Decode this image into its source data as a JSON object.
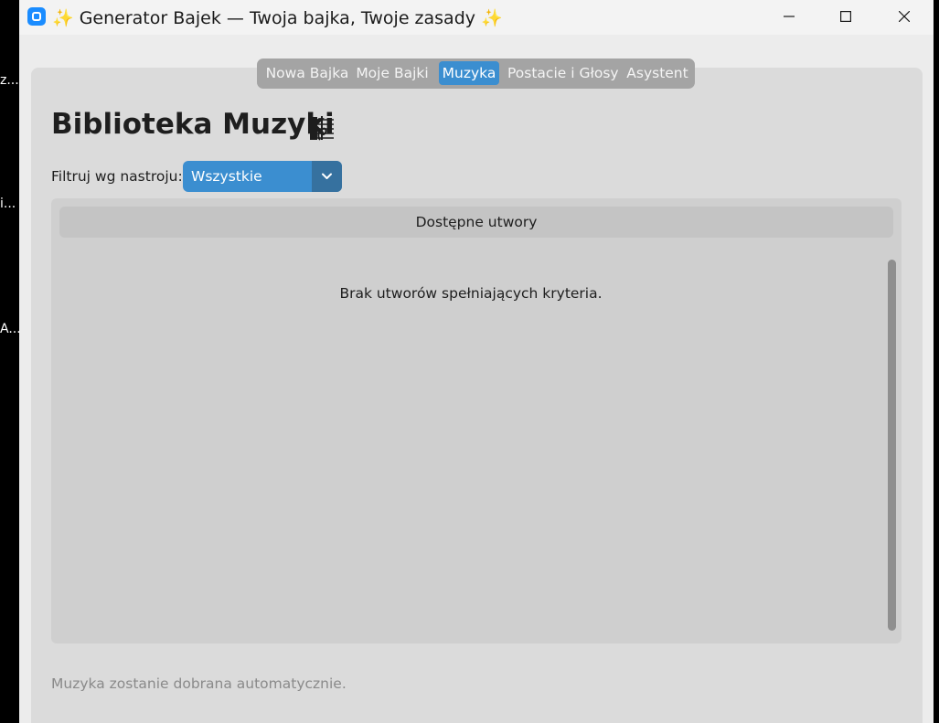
{
  "background_fragments": [
    "z...",
    "i...",
    "A..."
  ],
  "window": {
    "title": "✨ Generator Bajek — Twoja bajka, Twoje zasady ✨"
  },
  "tabs": [
    {
      "label": "Nowa Bajka",
      "active": false
    },
    {
      "label": "Moje Bajki",
      "active": false
    },
    {
      "label": "Muzyka",
      "active": true
    },
    {
      "label": "Postacie i Głosy",
      "active": false
    },
    {
      "label": "Asystent",
      "active": false
    }
  ],
  "page": {
    "title": "Biblioteka Muzyki",
    "title_icon": "music-score-icon"
  },
  "filter": {
    "label": "Filtruj wg nastroju:",
    "selected": "Wszystkie"
  },
  "tracks": {
    "header": "Dostępne utwory",
    "empty_message": "Brak utworów spełniających kryteria.",
    "items": []
  },
  "footer": {
    "note": "Muzyka zostanie dobrana automatycznie."
  },
  "colors": {
    "accent": "#3b8ed0",
    "accent_dark": "#36719f"
  }
}
